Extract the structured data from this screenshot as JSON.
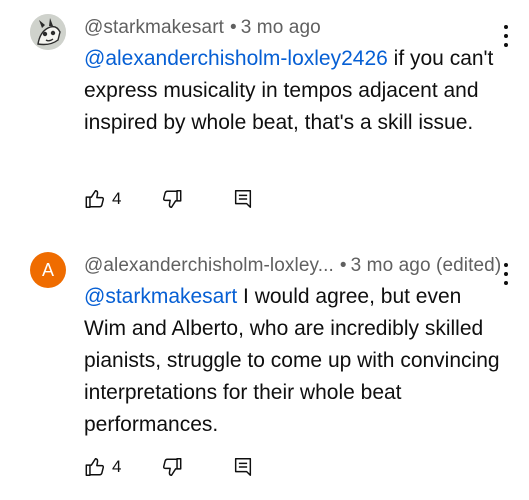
{
  "comments": [
    {
      "author": "@starkmakesart",
      "age": "3 mo ago",
      "edited": "",
      "avatar_icon": "cartoon-avatar-icon",
      "mention": "@alexanderchisholm-loxley2426",
      "text": " if you can't express musicality in tempos adjacent and inspired by whole beat, that's a skill issue.",
      "likes": "4"
    },
    {
      "author": "@alexanderchisholm-loxley...",
      "age": "3 mo ago",
      "edited": "(edited)",
      "avatar_letter": "A",
      "avatar_color": "#ef6c00",
      "mention": "@starkmakesart",
      "text": " I would agree, but even Wim and Alberto, who are incredibly skilled pianists, struggle to come up with convincing interpretations for their whole beat performances.",
      "likes": "4"
    }
  ],
  "colors": {
    "mention": "#065fd4",
    "meta": "#606060",
    "text": "#0f0f0f"
  }
}
